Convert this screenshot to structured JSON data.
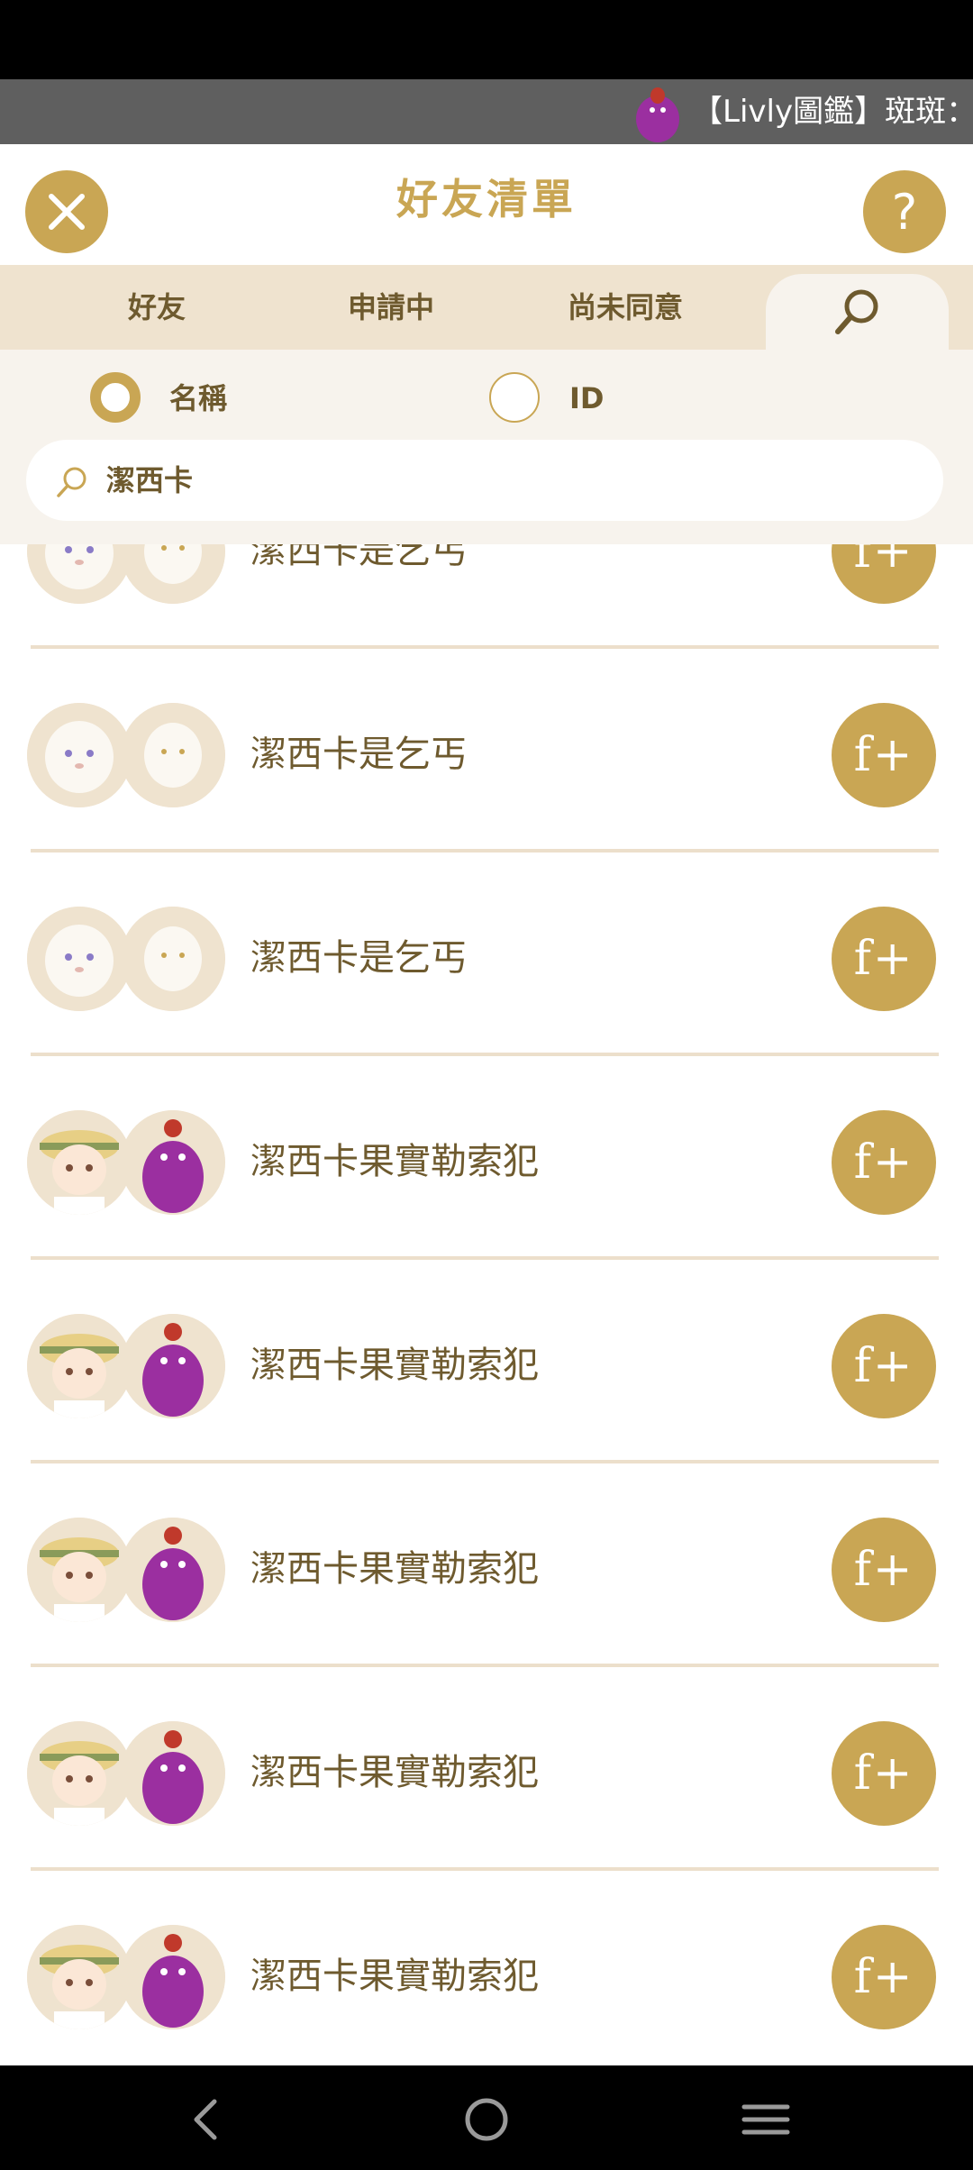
{
  "marquee": {
    "text": "【Livly圖鑑】斑斑："
  },
  "header": {
    "title": "好友清單",
    "help_label": "?"
  },
  "tabs": [
    {
      "label": "好友"
    },
    {
      "label": "申請中"
    },
    {
      "label": "尚未同意"
    }
  ],
  "search": {
    "options": [
      {
        "label": "名稱",
        "selected": true
      },
      {
        "label": "ID",
        "selected": false
      }
    ],
    "value": "潔西卡"
  },
  "results": [
    {
      "name": "潔西卡是乞丐",
      "avatar": "white-sheep"
    },
    {
      "name": "潔西卡是乞丐",
      "avatar": "white-sheep"
    },
    {
      "name": "潔西卡是乞丐",
      "avatar": "white-sheep"
    },
    {
      "name": "潔西卡果實勒索犯",
      "avatar": "purple-monster"
    },
    {
      "name": "潔西卡果實勒索犯",
      "avatar": "purple-monster"
    },
    {
      "name": "潔西卡果實勒索犯",
      "avatar": "purple-monster"
    },
    {
      "name": "潔西卡果實勒索犯",
      "avatar": "purple-monster"
    },
    {
      "name": "潔西卡果實勒索犯",
      "avatar": "purple-monster"
    }
  ],
  "add_button_label": "f+",
  "colors": {
    "accent": "#c9a654",
    "text": "#6e5a2e",
    "tab_bg": "#efe3cf",
    "panel_bg": "#f7f3ed"
  }
}
